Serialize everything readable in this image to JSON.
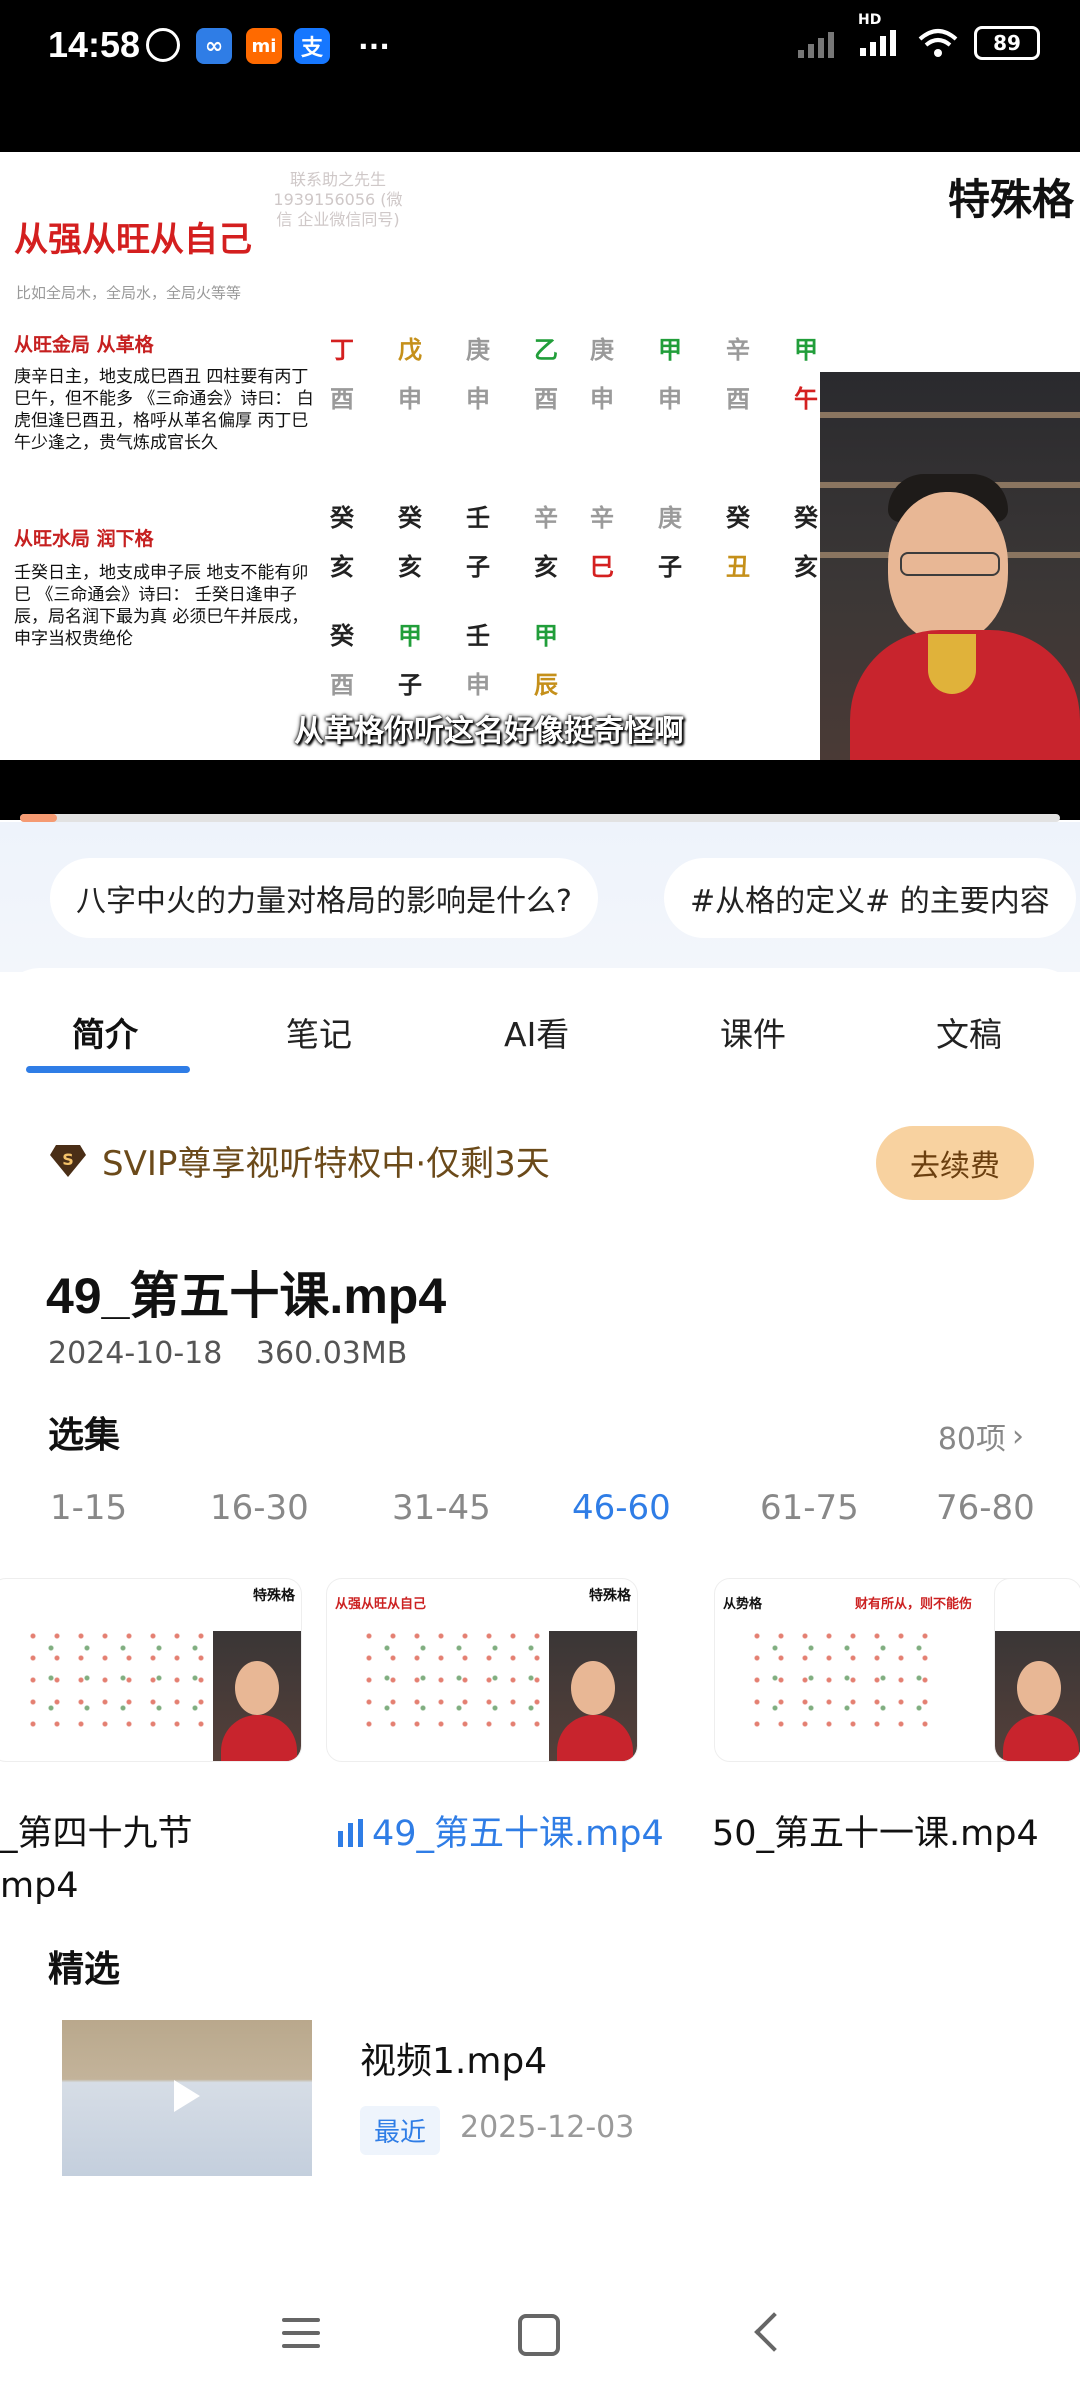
{
  "status_bar": {
    "time": "14:58",
    "app_icons": [
      "alarm-icon",
      "baidu-netdisk-icon",
      "mi-icon",
      "alipay-icon"
    ],
    "more": "···",
    "network": "HD",
    "battery": "89"
  },
  "video": {
    "slide_title": "从强从旺从自己",
    "slide_contact": "联系助之先生 1939156056 (微信 企业微信同号)",
    "slide_corner": "特殊格",
    "slide_sub": "比如全局木，全局水，全局火等等",
    "sec1_heading": "从旺金局 从革格",
    "sec1_text": "庚辛日主，地支成巳酉丑 四柱要有丙丁巳午，但不能多 《三命通会》诗曰： 白虎但逢巳酉丑，格呼从革名偏厚 丙丁巳午少逢之，贵气炼成官长久",
    "sec2_heading": "从旺水局 润下格",
    "sec2_text": "壬癸日主，地支成申子辰 地支不能有卯巳 《三命通会》诗曰： 壬癸日逢申子辰，局名润下最为真 必须巳午并辰戌，申字当权贵绝伦",
    "bazi_rows": [
      [
        "丁",
        "戊",
        "庚",
        "乙",
        "庚",
        "甲",
        "辛",
        "甲"
      ],
      [
        "酉",
        "申",
        "申",
        "酉",
        "申",
        "申",
        "酉",
        "午"
      ],
      [
        "癸",
        "癸",
        "壬",
        "辛",
        "辛",
        "庚",
        "癸",
        "癸"
      ],
      [
        "亥",
        "亥",
        "子",
        "亥",
        "巳",
        "子",
        "丑",
        "亥"
      ],
      [
        "癸",
        "甲",
        "壬",
        "甲"
      ],
      [
        "酉",
        "子",
        "申",
        "辰"
      ]
    ],
    "subtitle": "从革格你听这名好像挺奇怪啊",
    "progress": 0.036
  },
  "suggestions": [
    "八字中火的力量对格局的影响是什么?",
    "#从格的定义# 的主要内容"
  ],
  "tabs": [
    "简介",
    "笔记",
    "AI看",
    "课件",
    "文稿"
  ],
  "active_tab": "简介",
  "svip": {
    "text": "SVIP尊享视听特权中·仅剩3天",
    "button": "去续费"
  },
  "file": {
    "title": "49_第五十课.mp4",
    "date": "2024-10-18",
    "size": "360.03MB"
  },
  "episodes": {
    "heading": "选集",
    "count": "80项",
    "ranges": [
      "1-15",
      "16-30",
      "31-45",
      "46-60",
      "61-75",
      "76-80"
    ],
    "active_range": "46-60",
    "thumb_titles": [
      "特殊格",
      "从强从旺从自己",
      "特殊格",
      "从势格",
      "财有所从，则不能伤"
    ],
    "items": [
      {
        "name_line1": "_第四十九节",
        "name_line2": "mp4"
      },
      {
        "name": "49_第五十课.mp4"
      },
      {
        "name": "50_第五十一课.mp4"
      }
    ]
  },
  "featured": {
    "heading": "精选",
    "title": "视频1.mp4",
    "tag": "最近",
    "date": "2025-12-03"
  },
  "colors": {
    "accent": "#2f7de6",
    "svip_bg": "#f8d2a0",
    "slide_red": "#d41f1f",
    "progress": "#f59a72"
  }
}
